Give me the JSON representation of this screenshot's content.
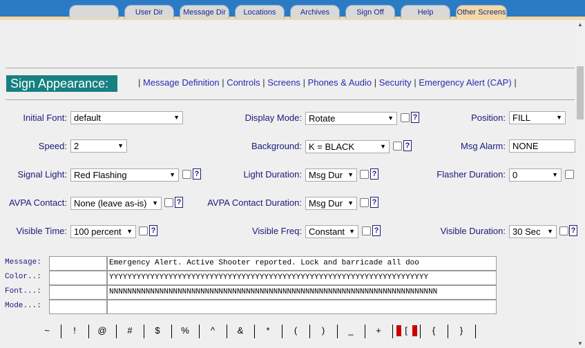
{
  "tabs": [
    {
      "label": ""
    },
    {
      "label": "User Dir"
    },
    {
      "label": "Message Dir"
    },
    {
      "label": "Locations"
    },
    {
      "label": "Archives"
    },
    {
      "label": "Sign Off"
    },
    {
      "label": "Help"
    },
    {
      "label": "Other Screens",
      "active": true
    }
  ],
  "section": {
    "title": "Sign Appearance:"
  },
  "nav": {
    "links": [
      "Message Definition",
      "Controls",
      "Screens",
      "Phones & Audio",
      "Security",
      "Emergency Alert (CAP)"
    ]
  },
  "form": {
    "initial_font": {
      "label": "Initial Font:",
      "value": "default"
    },
    "display_mode": {
      "label": "Display Mode:",
      "value": "Rotate"
    },
    "position": {
      "label": "Position:",
      "value": "FILL"
    },
    "speed": {
      "label": "Speed:",
      "value": "2"
    },
    "background": {
      "label": "Background:",
      "value": "K = BLACK"
    },
    "msg_alarm": {
      "label": "Msg Alarm:",
      "value": "NONE"
    },
    "signal_light": {
      "label": "Signal Light:",
      "value": "Red Flashing"
    },
    "light_duration": {
      "label": "Light Duration:",
      "value": "Msg Dur"
    },
    "flasher_duration": {
      "label": "Flasher Duration:",
      "value": "0"
    },
    "avpa_contact": {
      "label": "AVPA Contact:",
      "value": "None (leave as-is)"
    },
    "avpa_contact_duration": {
      "label": "AVPA Contact Duration:",
      "value": "Msg Dur"
    },
    "visible_time": {
      "label": "Visible Time:",
      "value": "100 percent"
    },
    "visible_freq": {
      "label": "Visible Freq:",
      "value": "Constant"
    },
    "visible_duration": {
      "label": "Visible Duration:",
      "value": "30 Sec"
    },
    "help_glyph": "?"
  },
  "message": {
    "labels": {
      "message": "Message:",
      "color": "Color..:",
      "font": "Font...:",
      "mode": "Mode...:"
    },
    "message_text": "Emergency Alert.  Active Shooter reported.  Lock and barricade all doo",
    "color_text": "YYYYYYYYYYYYYYYYYYYYYYYYYYYYYYYYYYYYYYYYYYYYYYYYYYYYYYYYYYYYYYYYYYYYYY",
    "font_text": "NNNNNNNNNNNNNNNNNNNNNNNNNNNNNNNNNNNNNNNNNNNNNNNNNNNNNNNNNNNNNNNNNNNNNNNN",
    "mode_text": ""
  },
  "symbols": [
    "~",
    "!",
    "@",
    "#",
    "$",
    "%",
    "^",
    "&",
    "*",
    "(",
    ")",
    "_",
    "+",
    "[",
    "{",
    "}"
  ],
  "colors": {
    "tab_bar": "#2a7bc4",
    "section_header": "#178080",
    "label_text": "#1a1a7a"
  }
}
